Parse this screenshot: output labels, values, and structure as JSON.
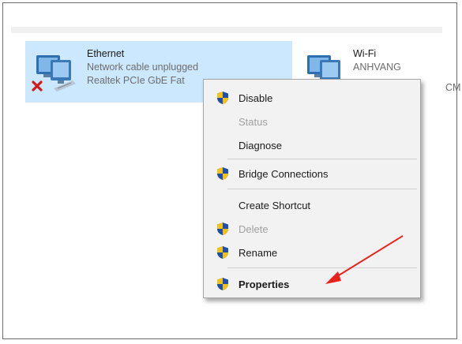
{
  "adapters": [
    {
      "name": "Ethernet",
      "status": "Network cable unplugged",
      "device": "Realtek PCIe GbE Fat"
    },
    {
      "name": "Wi-Fi",
      "status": "ANHVANG",
      "device": ""
    }
  ],
  "wifi_device_fragment": "CM",
  "context_menu": {
    "items": [
      {
        "label": "Disable",
        "shield": true,
        "enabled": true
      },
      {
        "label": "Status",
        "shield": false,
        "enabled": false
      },
      {
        "label": "Diagnose",
        "shield": false,
        "enabled": true
      },
      {
        "label": "Bridge Connections",
        "shield": true,
        "enabled": true
      },
      {
        "label": "Create Shortcut",
        "shield": false,
        "enabled": true
      },
      {
        "label": "Delete",
        "shield": true,
        "enabled": false
      },
      {
        "label": "Rename",
        "shield": true,
        "enabled": true
      },
      {
        "label": "Properties",
        "shield": true,
        "enabled": true,
        "bold": true
      }
    ]
  },
  "colors": {
    "selection": "#cce8ff",
    "arrow": "#e8221b",
    "error_x": "#d11b1b",
    "status_dot": "#2e9b3a"
  }
}
